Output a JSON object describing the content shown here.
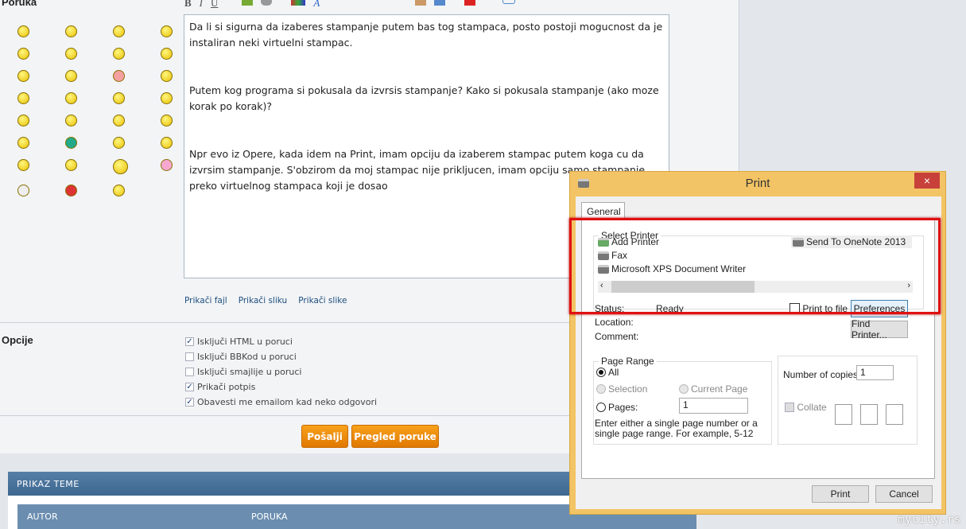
{
  "form": {
    "message_label": "Poruka",
    "options_label": "Opcije",
    "toolbar": [
      "B",
      "I",
      "U"
    ],
    "editor_paragraphs": [
      "Da li si sigurna da izaberes stampanje putem bas tog stampaca, posto postoji mogucnost da je instaliran neki virtuelni stampac.",
      "Putem kog programa si pokusala da izvrsis stampanje? Kako si pokusala stampanje (ako moze korak po korak)?",
      "Npr evo iz Opere, kada idem na Print, imam opciju da izaberem stampac putem koga cu da izvrsim stampanje. S'obzirom da moj stampac nije prikljucen, imam opciju samo stampanje preko virtuelnog stampaca koji je dosao"
    ],
    "attach": [
      "Prikači fajl",
      "Prikači sliku",
      "Prikači slike"
    ],
    "options": [
      {
        "label": "Isključi HTML u poruci",
        "checked": true
      },
      {
        "label": "Isključi BBKod u poruci",
        "checked": false
      },
      {
        "label": "Isključi smajlije u poruci",
        "checked": false
      },
      {
        "label": "Prikači potpis",
        "checked": true
      },
      {
        "label": "Obavesti me emailom kad neko odgovori",
        "checked": true
      }
    ],
    "send": "Pošalji",
    "preview": "Pregled poruke"
  },
  "thread": {
    "title": "PRIKAZ TEME",
    "col_author": "AUTOR",
    "col_message": "PORUKA"
  },
  "watermark": "mycity.rs",
  "dialog": {
    "title": "Print",
    "tab": "General",
    "select_printer": "Select Printer",
    "printers": [
      "Add Printer",
      "Fax",
      "Microsoft XPS Document Writer",
      "Send To OneNote 2013"
    ],
    "status_label": "Status:",
    "status": "Ready",
    "location_label": "Location:",
    "comment_label": "Comment:",
    "print_to_file": "Print to file",
    "preferences": "Preferences",
    "find_printer": "Find Printer...",
    "page_range": "Page Range",
    "all": "All",
    "selection": "Selection",
    "current_page": "Current Page",
    "pages": "Pages:",
    "pages_value": "1",
    "hint": "Enter either a single page number or a single page range.  For example, 5-12",
    "copies_label": "Number of copies:",
    "copies": "1",
    "collate": "Collate",
    "print": "Print",
    "cancel": "Cancel",
    "close": "×"
  }
}
